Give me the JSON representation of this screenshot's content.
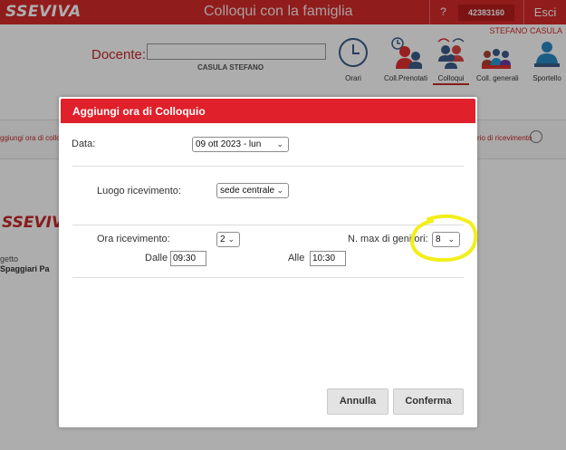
{
  "header": {
    "brand": "SSEVIVA",
    "title": "Colloqui con la famiglia",
    "help": "?",
    "account_code": "42383160",
    "logout": "Esci",
    "user_name": "STEFANO CASULA",
    "accent_color": "#d62a2a"
  },
  "teacher": {
    "label": "Docente:",
    "name": "CASULA STEFANO"
  },
  "nav": {
    "items": [
      {
        "label": "Orari",
        "icon": "clock-icon"
      },
      {
        "label": "Coll.Prenotati",
        "icon": "booked-clock-icon"
      },
      {
        "label": "Colloqui",
        "icon": "meeting-people-icon",
        "active": true
      },
      {
        "label": "Coll. generali",
        "icon": "group-icon"
      },
      {
        "label": "Sportello",
        "icon": "person-icon"
      }
    ]
  },
  "breadcrumb": {
    "left": "ggiungi ora di collo",
    "right": "rio di ricevimento"
  },
  "sidebar": {
    "logo": "SSEVIV",
    "text1": "getto",
    "text2": "Spaggiari Pa"
  },
  "modal": {
    "title": "Aggiungi ora di Colloquio",
    "date_label": "Data:",
    "date_value": "09 ott 2023 - lun",
    "place_label": "Luogo ricevimento:",
    "place_value": "sede centrale",
    "hour_label": "Ora ricevimento:",
    "hour_value": "2",
    "max_label": "N. max di genitori:",
    "max_value": "8",
    "from_label": "Dalle",
    "from_value": "09:30",
    "to_label": "Alle",
    "to_value": "10:30",
    "cancel": "Annulla",
    "confirm": "Conferma"
  },
  "annotation": {
    "highlight_color": "#f2ee1a"
  }
}
